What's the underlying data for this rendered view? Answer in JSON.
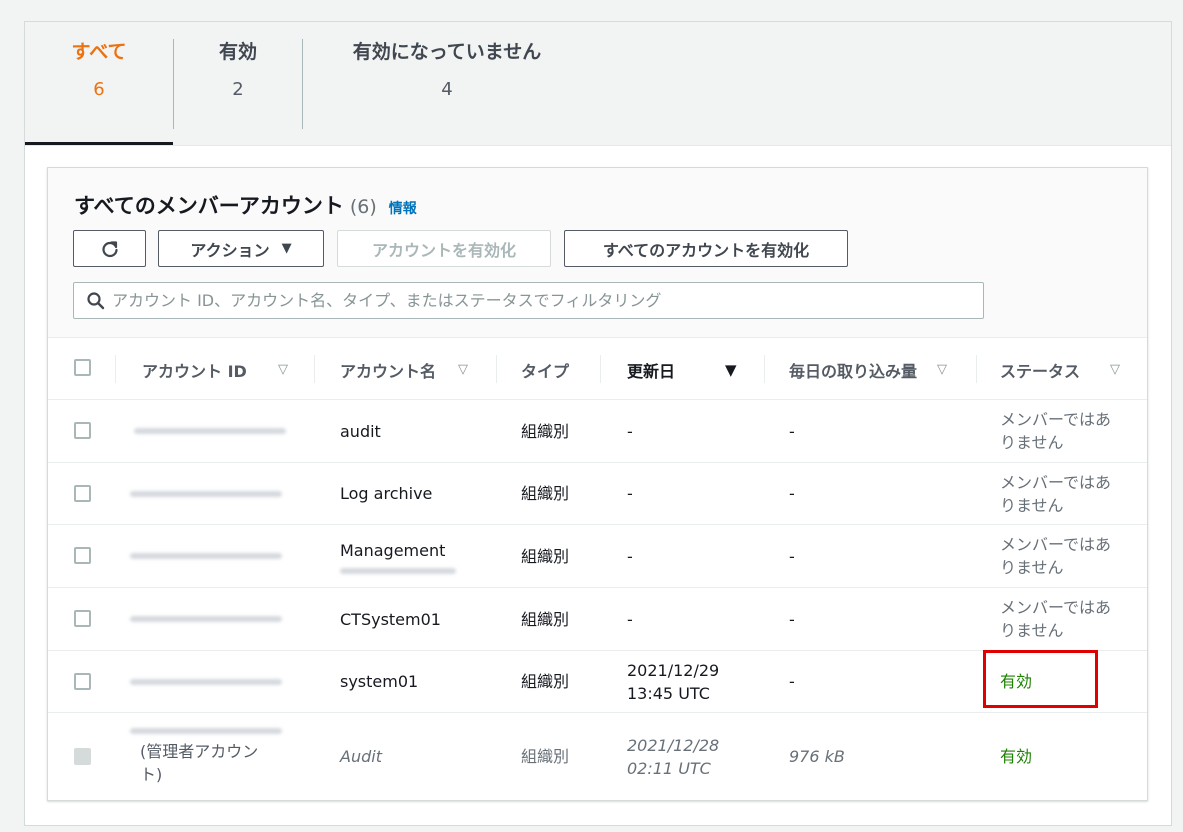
{
  "tabs": [
    {
      "label": "すべて",
      "count": "6"
    },
    {
      "label": "有効",
      "count": "2"
    },
    {
      "label": "有効になっていません",
      "count": "4"
    }
  ],
  "panel": {
    "title": "すべてのメンバーアカウント",
    "count": "(6)",
    "info_link": "情報"
  },
  "toolbar": {
    "actions_label": "アクション",
    "enable_account_label": "アカウントを有効化",
    "enable_all_label": "すべてのアカウントを有効化"
  },
  "search": {
    "placeholder": "アカウント ID、アカウント名、タイプ、またはステータスでフィルタリング"
  },
  "columns": {
    "account_id": "アカウント ID",
    "account_name": "アカウント名",
    "type": "タイプ",
    "updated": "更新日",
    "daily_ingest": "毎日の取り込み量",
    "status": "ステータス"
  },
  "rows": [
    {
      "name": "audit",
      "type": "組織別",
      "updated_1": "-",
      "updated_2": "",
      "ingest": "-",
      "status_1": "メンバーではあ",
      "status_2": "りません"
    },
    {
      "name": "Log archive",
      "type": "組織別",
      "updated_1": "-",
      "updated_2": "",
      "ingest": "-",
      "status_1": "メンバーではあ",
      "status_2": "りません"
    },
    {
      "name": "Management",
      "type": "組織別",
      "updated_1": "-",
      "updated_2": "",
      "ingest": "-",
      "status_1": "メンバーではあ",
      "status_2": "りません"
    },
    {
      "name": "CTSystem01",
      "type": "組織別",
      "updated_1": "-",
      "updated_2": "",
      "ingest": "-",
      "status_1": "メンバーではあ",
      "status_2": "りません"
    },
    {
      "name": "system01",
      "type": "組織別",
      "updated_1": "2021/12/29",
      "updated_2": "13:45 UTC",
      "ingest": "-",
      "status_1": "有効",
      "status_2": ""
    },
    {
      "name": "Audit",
      "type": "組織別",
      "updated_1": "2021/12/28",
      "updated_2": "02:11 UTC",
      "ingest": "976 kB",
      "status_1": "有効",
      "status_2": "",
      "admin_note_1": "(管理者アカウン",
      "admin_note_2": "ト)"
    }
  ],
  "colors": {
    "active_tab": "#ec7211",
    "link": "#0073bb",
    "status_enabled": "#1d8102",
    "highlight": "#e00000"
  }
}
